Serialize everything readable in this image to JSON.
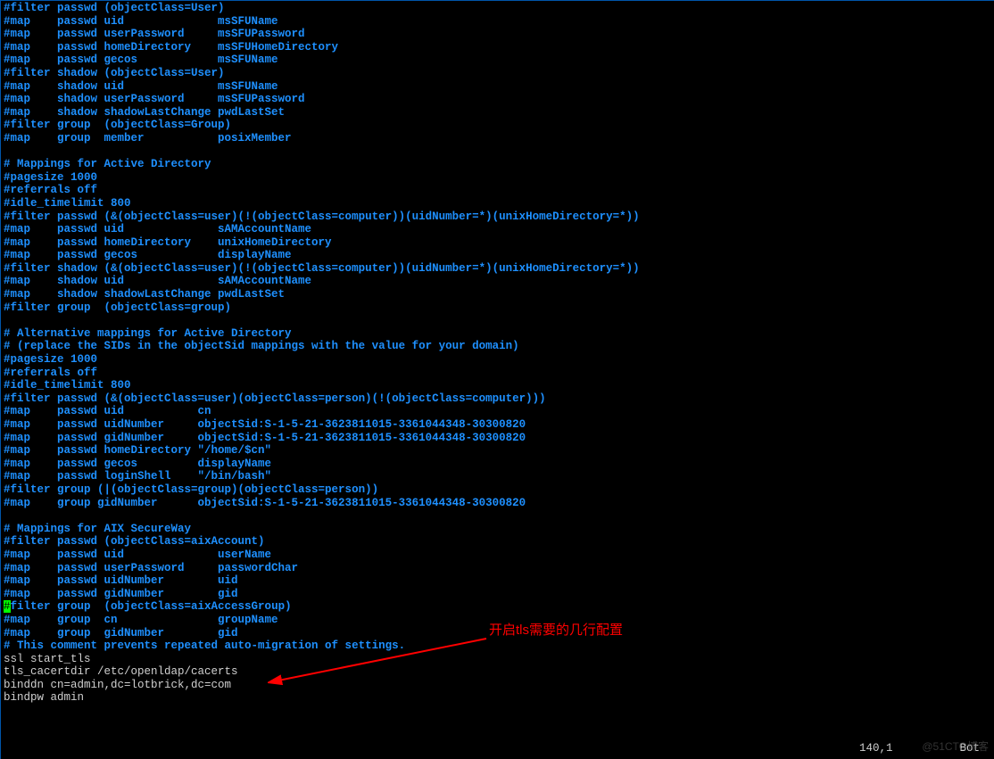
{
  "lines": [
    {
      "t": "c",
      "v": "#filter passwd (objectClass=User)"
    },
    {
      "t": "c",
      "v": "#map    passwd uid              msSFUName"
    },
    {
      "t": "c",
      "v": "#map    passwd userPassword     msSFUPassword"
    },
    {
      "t": "c",
      "v": "#map    passwd homeDirectory    msSFUHomeDirectory"
    },
    {
      "t": "c",
      "v": "#map    passwd gecos            msSFUName"
    },
    {
      "t": "c",
      "v": "#filter shadow (objectClass=User)"
    },
    {
      "t": "c",
      "v": "#map    shadow uid              msSFUName"
    },
    {
      "t": "c",
      "v": "#map    shadow userPassword     msSFUPassword"
    },
    {
      "t": "c",
      "v": "#map    shadow shadowLastChange pwdLastSet"
    },
    {
      "t": "c",
      "v": "#filter group  (objectClass=Group)"
    },
    {
      "t": "c",
      "v": "#map    group  member           posixMember"
    },
    {
      "t": "b",
      "v": ""
    },
    {
      "t": "c",
      "v": "# Mappings for Active Directory"
    },
    {
      "t": "c",
      "v": "#pagesize 1000"
    },
    {
      "t": "c",
      "v": "#referrals off"
    },
    {
      "t": "c",
      "v": "#idle_timelimit 800"
    },
    {
      "t": "c",
      "v": "#filter passwd (&(objectClass=user)(!(objectClass=computer))(uidNumber=*)(unixHomeDirectory=*))"
    },
    {
      "t": "c",
      "v": "#map    passwd uid              sAMAccountName"
    },
    {
      "t": "c",
      "v": "#map    passwd homeDirectory    unixHomeDirectory"
    },
    {
      "t": "c",
      "v": "#map    passwd gecos            displayName"
    },
    {
      "t": "c",
      "v": "#filter shadow (&(objectClass=user)(!(objectClass=computer))(uidNumber=*)(unixHomeDirectory=*))"
    },
    {
      "t": "c",
      "v": "#map    shadow uid              sAMAccountName"
    },
    {
      "t": "c",
      "v": "#map    shadow shadowLastChange pwdLastSet"
    },
    {
      "t": "c",
      "v": "#filter group  (objectClass=group)"
    },
    {
      "t": "b",
      "v": ""
    },
    {
      "t": "c",
      "v": "# Alternative mappings for Active Directory"
    },
    {
      "t": "c",
      "v": "# (replace the SIDs in the objectSid mappings with the value for your domain)"
    },
    {
      "t": "c",
      "v": "#pagesize 1000"
    },
    {
      "t": "c",
      "v": "#referrals off"
    },
    {
      "t": "c",
      "v": "#idle_timelimit 800"
    },
    {
      "t": "c",
      "v": "#filter passwd (&(objectClass=user)(objectClass=person)(!(objectClass=computer)))"
    },
    {
      "t": "c",
      "v": "#map    passwd uid           cn"
    },
    {
      "t": "c",
      "v": "#map    passwd uidNumber     objectSid:S-1-5-21-3623811015-3361044348-30300820"
    },
    {
      "t": "c",
      "v": "#map    passwd gidNumber     objectSid:S-1-5-21-3623811015-3361044348-30300820"
    },
    {
      "t": "c",
      "v": "#map    passwd homeDirectory \"/home/$cn\""
    },
    {
      "t": "c",
      "v": "#map    passwd gecos         displayName"
    },
    {
      "t": "c",
      "v": "#map    passwd loginShell    \"/bin/bash\""
    },
    {
      "t": "c",
      "v": "#filter group (|(objectClass=group)(objectClass=person))"
    },
    {
      "t": "c",
      "v": "#map    group gidNumber      objectSid:S-1-5-21-3623811015-3361044348-30300820"
    },
    {
      "t": "b",
      "v": ""
    },
    {
      "t": "c",
      "v": "# Mappings for AIX SecureWay"
    },
    {
      "t": "c",
      "v": "#filter passwd (objectClass=aixAccount)"
    },
    {
      "t": "c",
      "v": "#map    passwd uid              userName"
    },
    {
      "t": "c",
      "v": "#map    passwd userPassword     passwordChar"
    },
    {
      "t": "c",
      "v": "#map    passwd uidNumber        uid"
    },
    {
      "t": "c",
      "v": "#map    passwd gidNumber        gid"
    },
    {
      "t": "h",
      "v": "#filter group  (objectClass=aixAccessGroup)"
    },
    {
      "t": "c",
      "v": "#map    group  cn               groupName"
    },
    {
      "t": "c",
      "v": "#map    group  gidNumber        gid"
    },
    {
      "t": "c",
      "v": "# This comment prevents repeated auto-migration of settings."
    },
    {
      "t": "w",
      "v": "ssl start_tls"
    },
    {
      "t": "w",
      "v": "tls_cacertdir /etc/openldap/cacerts"
    },
    {
      "t": "w",
      "v": "binddn cn=admin,dc=lotbrick,dc=com"
    },
    {
      "t": "w",
      "v": "bindpw admin"
    }
  ],
  "annotation": "开启tls需要的几行配置",
  "status_pos": "140,1",
  "status_loc": "Bot",
  "watermark": "@51CTO博客"
}
